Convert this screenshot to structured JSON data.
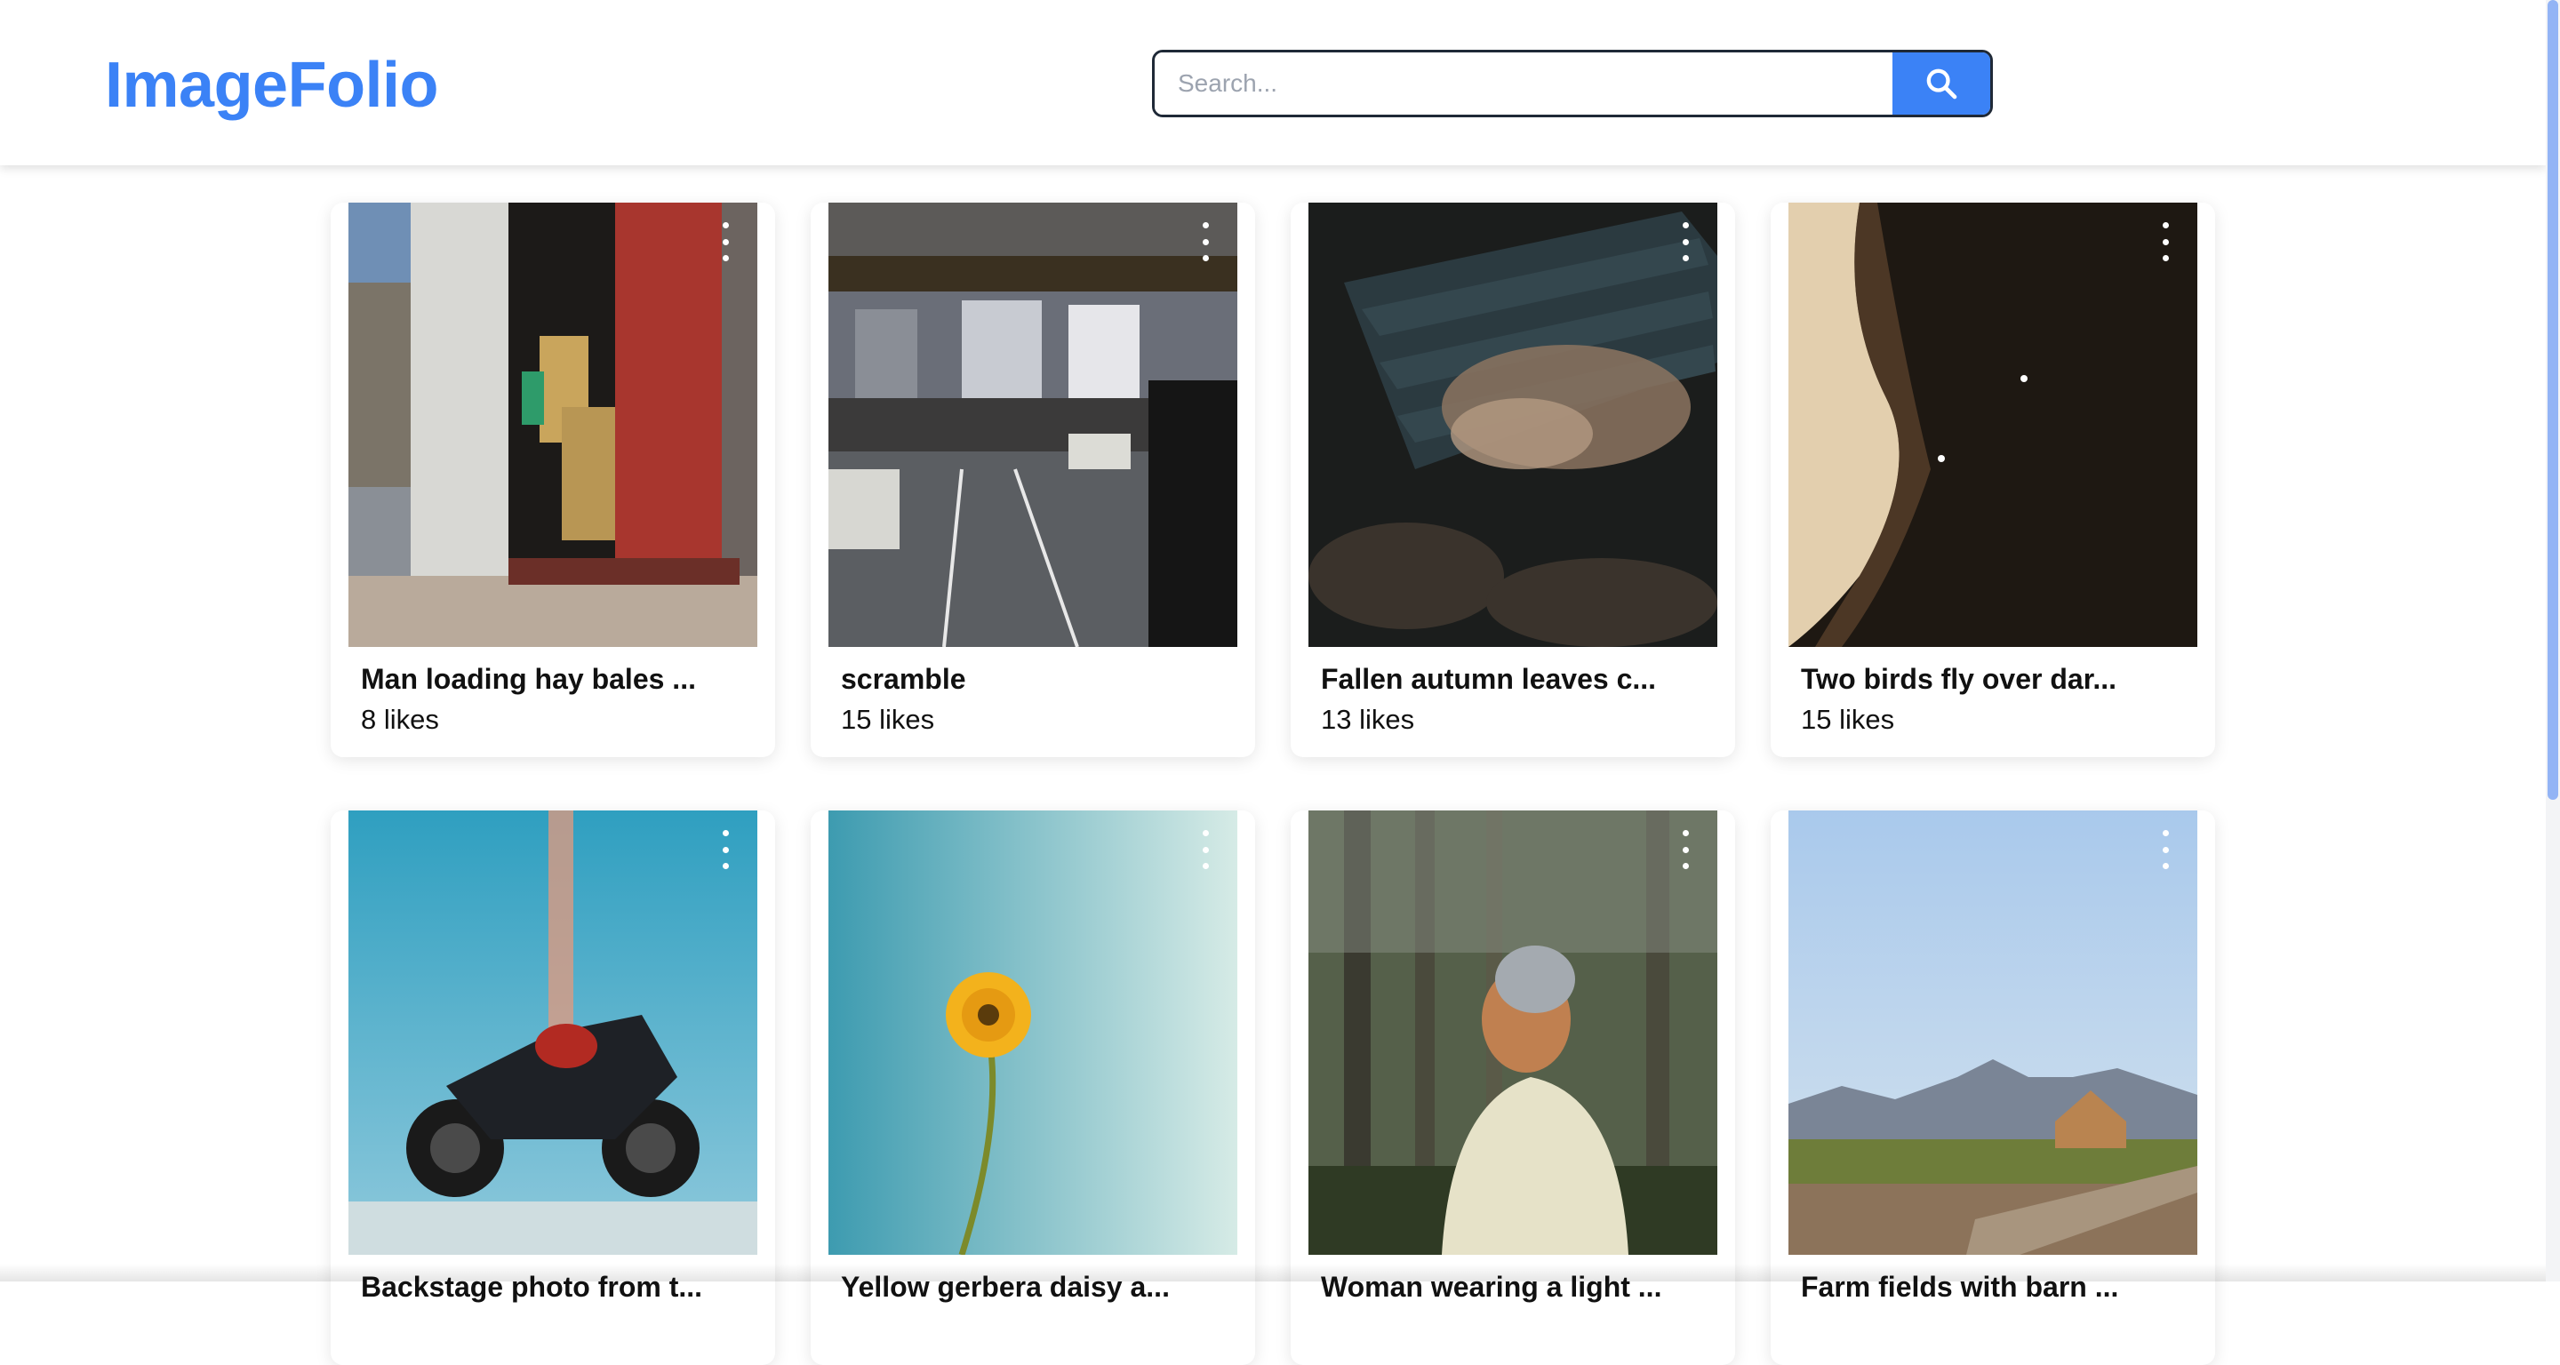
{
  "header": {
    "logo": "ImageFolio",
    "search": {
      "placeholder": "Search...",
      "value": ""
    },
    "search_button_icon": "search-icon"
  },
  "colors": {
    "accent": "#3b82f6",
    "text": "#111111"
  },
  "cards": [
    {
      "title": "Man loading hay bales ...",
      "likes": "8 likes",
      "menu_icon": "more-vertical-icon"
    },
    {
      "title": "scramble",
      "likes": "15 likes",
      "menu_icon": "more-vertical-icon"
    },
    {
      "title": "Fallen autumn leaves c...",
      "likes": "13 likes",
      "menu_icon": "more-vertical-icon"
    },
    {
      "title": "Two birds fly over dar...",
      "likes": "15 likes",
      "menu_icon": "more-vertical-icon"
    },
    {
      "title": "Backstage photo from t...",
      "likes": "",
      "menu_icon": "more-vertical-icon"
    },
    {
      "title": "Yellow gerbera daisy a...",
      "likes": "",
      "menu_icon": "more-vertical-icon"
    },
    {
      "title": "Woman wearing a light ...",
      "likes": "",
      "menu_icon": "more-vertical-icon"
    },
    {
      "title": "Farm fields with barn ...",
      "likes": "",
      "menu_icon": "more-vertical-icon"
    }
  ]
}
